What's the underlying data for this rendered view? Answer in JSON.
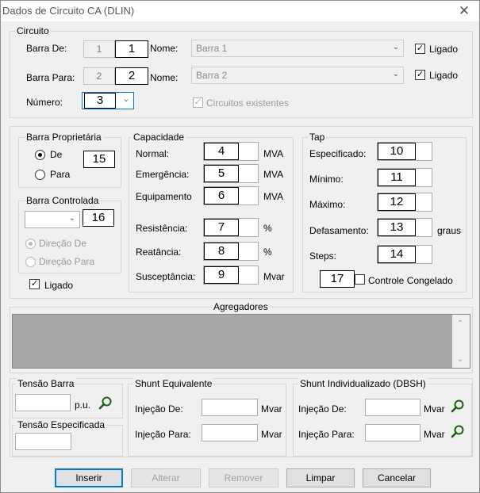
{
  "window": {
    "title": "Dados de Circuito CA (DLIN)",
    "close_glyph": "✕"
  },
  "circuito": {
    "legend": "Circuito",
    "barra_de_label": "Barra De:",
    "barra_de_value": "1",
    "barra_de_tag": "1",
    "nome_label": "Nome:",
    "barra_de_nome": "Barra 1",
    "barra_para_label": "Barra Para:",
    "barra_para_value": "2",
    "barra_para_tag": "2",
    "barra_para_nome": "Barra 2",
    "ligado_label": "Ligado",
    "numero_label": "Número:",
    "numero_value": "3",
    "circuitos_existentes_label": "Circuitos existentes"
  },
  "barra_proprietaria": {
    "legend": "Barra Proprietária",
    "de_label": "De",
    "para_label": "Para",
    "tag": "15"
  },
  "barra_controlada": {
    "legend": "Barra Controlada",
    "tag": "16",
    "direcao_de_label": "Direção De",
    "direcao_para_label": "Direção Para",
    "ligado_label": "Ligado"
  },
  "capacidade": {
    "legend": "Capacidade",
    "normal_label": "Normal:",
    "normal_tag": "4",
    "emergencia_label": "Emergência:",
    "emergencia_tag": "5",
    "equipamento_label": "Equipamento",
    "equipamento_tag": "6",
    "unit_mva": "MVA",
    "resistencia_label": "Resistência:",
    "resistencia_tag": "7",
    "reatancia_label": "Reatância:",
    "reatancia_tag": "8",
    "unit_pct": "%",
    "susceptancia_label": "Susceptância:",
    "susceptancia_tag": "9",
    "unit_mvar": "Mvar"
  },
  "tap": {
    "legend": "Tap",
    "especificado_label": "Especificado:",
    "especificado_tag": "10",
    "minimo_label": "Mínimo:",
    "minimo_tag": "11",
    "maximo_label": "Máximo:",
    "maximo_tag": "12",
    "defasamento_label": "Defasamento:",
    "defasamento_tag": "13",
    "unit_graus": "graus",
    "steps_label": "Steps:",
    "steps_tag": "14",
    "controle_tag": "17",
    "controle_label": "Controle Congelado"
  },
  "agregadores": {
    "legend": "Agregadores"
  },
  "tensao_barra": {
    "legend": "Tensão Barra",
    "unit": "p.u."
  },
  "tensao_especificada": {
    "legend": "Tensão Especificada"
  },
  "shunt_equivalente": {
    "legend": "Shunt Equivalente",
    "injecao_de_label": "Injeção De:",
    "injecao_para_label": "Injeção Para:",
    "unit_de": "Mvar",
    "unit_para": "Mvar"
  },
  "shunt_individualizado": {
    "legend": "Shunt Individualizado (DBSH)",
    "injecao_de_label": "Injeção De:",
    "injecao_para_label": "Injeção Para:",
    "unit": "Mvar"
  },
  "buttons": {
    "inserir": "Inserir",
    "alterar": "Alterar",
    "remover": "Remover",
    "limpar": "Limpar",
    "cancelar": "Cancelar"
  },
  "icons": {
    "search": "search-icon",
    "chevron": "chevron-down-icon",
    "check": "check-icon",
    "close": "close-icon"
  }
}
